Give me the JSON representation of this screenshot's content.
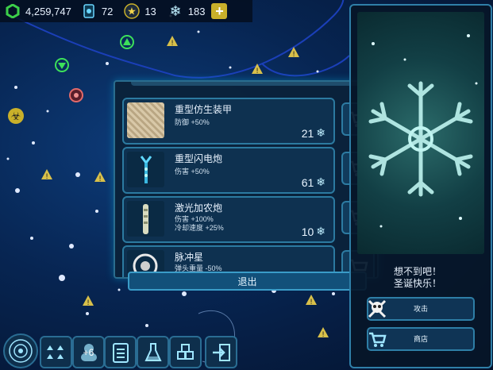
{
  "resources": {
    "credits": "4,259,747",
    "crystals": "72",
    "stars": "13",
    "snowflakes": "183",
    "add_icon": "plus-icon"
  },
  "shop": {
    "items": [
      {
        "name": "重型仿生装甲",
        "stats": [
          "防御 +50%"
        ],
        "price": "21",
        "icon": "bio-armor-icon"
      },
      {
        "name": "重型闪电炮",
        "stats": [
          "伤害 +50%"
        ],
        "price": "61",
        "icon": "lightning-cannon-icon"
      },
      {
        "name": "激光加农炮",
        "stats": [
          "伤害 +100%",
          "冷却速度 +25%"
        ],
        "price": "10",
        "icon": "laser-cannon-icon"
      },
      {
        "name": "脉冲星",
        "stats": [
          "弹头重量 -50%"
        ],
        "price": "",
        "icon": "pulsar-icon"
      }
    ],
    "exit_label": "退出",
    "currency_icon": "snowflake-icon"
  },
  "side_panel": {
    "message_line1": "想不到吧！",
    "message_line2": "圣诞快乐！",
    "attack_label": "攻击",
    "shop_label": "商店"
  },
  "toolbar": {
    "fleet_badge": "+6",
    "buttons": [
      "galaxy-map-icon",
      "fleet-icon",
      "recruit-icon",
      "missions-icon",
      "research-icon",
      "resources-icon",
      "exit-icon"
    ]
  },
  "colors": {
    "accent": "#2f7fa8",
    "button_fill": "#0f3455",
    "warning": "#e0c44a",
    "gold": "#c9b02a"
  }
}
